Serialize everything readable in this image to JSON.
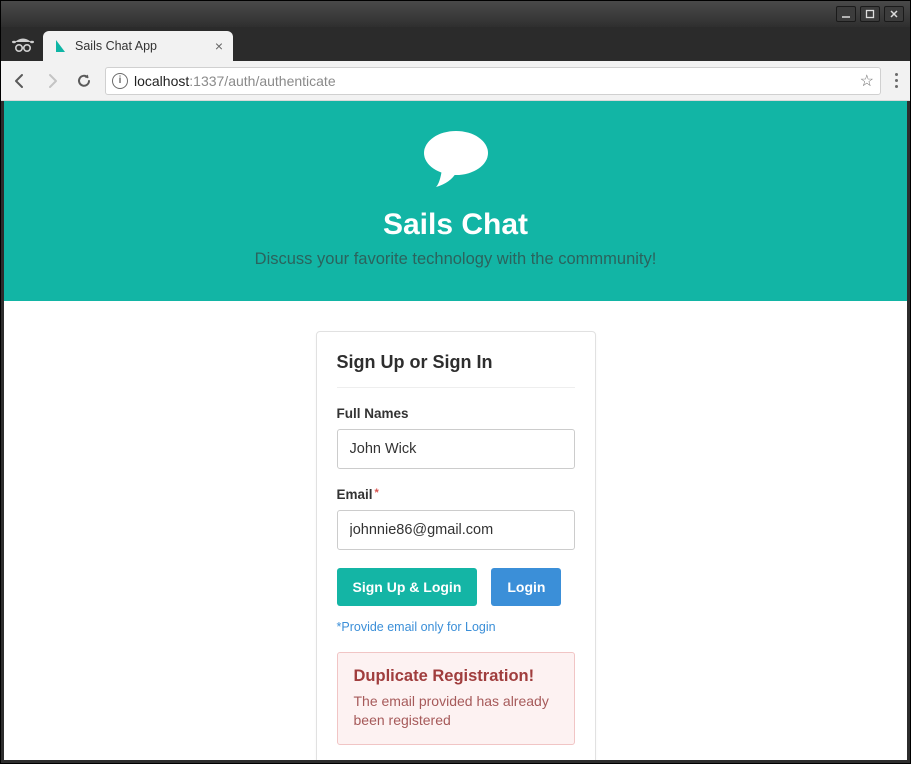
{
  "browser": {
    "tab_title": "Sails Chat App",
    "url_host": "localhost",
    "url_port_path": ":1337/auth/authenticate"
  },
  "hero": {
    "title": "Sails Chat",
    "subtitle": "Discuss your favorite technology with the commmunity!"
  },
  "form": {
    "heading": "Sign Up or Sign In",
    "fullname_label": "Full Names",
    "fullname_value": "John Wick",
    "email_label": "Email",
    "email_required_mark": "*",
    "email_value": "johnnie86@gmail.com",
    "signup_btn": "Sign Up & Login",
    "login_btn": "Login",
    "hint": "*Provide email only for Login"
  },
  "alert": {
    "title": "Duplicate Registration!",
    "message": "The email provided has already been registered"
  }
}
